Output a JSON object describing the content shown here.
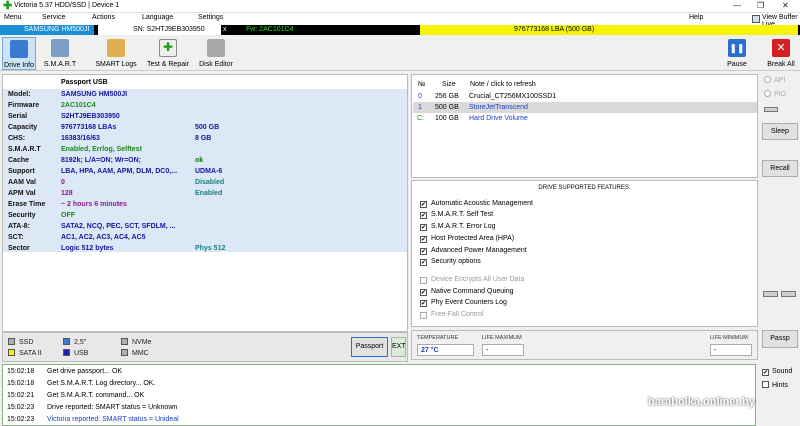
{
  "window": {
    "title": "Victoria 5.37 HDD/SSD | Device 1"
  },
  "menu": [
    "Menu",
    "Service",
    "Actions",
    "Language",
    "Settings",
    "Help"
  ],
  "view_buffer_live": "View Buffer Live",
  "device_bar": {
    "model": "SAMSUNG HM500JI",
    "sn": "SN: S2HTJ9EB303950",
    "x": "x",
    "fw": "Fw: 2AC101C4",
    "lba": "976773168 LBA (500 GB)"
  },
  "toolbar": [
    "Drive Info",
    "S.M.A.R.T",
    "SMART Logs",
    "Test & Repair",
    "Disk Editor"
  ],
  "pause_label": "Pause",
  "break_label": "Break All",
  "passport": {
    "header": "Passport USB",
    "rows": [
      {
        "k": "Model:",
        "v": "SAMSUNG HM500JI",
        "v2": ""
      },
      {
        "k": "Firmware",
        "v": "2AC101C4",
        "v2": ""
      },
      {
        "k": "Serial",
        "v": "S2HTJ9EB303950",
        "v2": ""
      },
      {
        "k": "Capacity",
        "v": "976773168 LBAs",
        "v2": "500 GB"
      },
      {
        "k": "CHS:",
        "v": "16383/16/63",
        "v2": "8 GB"
      },
      {
        "k": "S.M.A.R.T",
        "v": "Enabled, Errlog, Selftest",
        "v2": ""
      },
      {
        "k": "Cache",
        "v": "8192k; L/A=ON; Wr=ON;",
        "v2": "ok"
      },
      {
        "k": "Support",
        "v": "LBA, HPA, AAM, APM, DLM, DC0,...",
        "v2": "UDMA-6"
      },
      {
        "k": "AAM Val",
        "v": "0",
        "v2": "Disabled"
      },
      {
        "k": "APM Val",
        "v": "128",
        "v2": "Enabled"
      },
      {
        "k": "Erase Time",
        "v": "~ 2 hours 6 minutes",
        "v2": ""
      },
      {
        "k": "Security",
        "v": "OFF",
        "v2": ""
      },
      {
        "k": "ATA-8:",
        "v": "SATA2, NCQ, PEC, SCT, SFDLM, ...",
        "v2": ""
      },
      {
        "k": "SCT:",
        "v": "AC1, AC2, AC3, AC4, AC5",
        "v2": ""
      },
      {
        "k": "Sector",
        "v": "Logic 512 bytes",
        "v2": "Phys 512"
      }
    ]
  },
  "legend": {
    "items": [
      "SSD",
      "2,5\"",
      "NVMe",
      "SATA II",
      "USB",
      "MMC"
    ],
    "colors": [
      "#b0b0b0",
      "#3a7ad0",
      "#b0b0b0",
      "#f5f500",
      "#2020b0",
      "#b0b0b0"
    ],
    "passport_button": "Passport",
    "ext_button": "EXT"
  },
  "drive_list": {
    "headers": [
      "№",
      "Size",
      "Note / click to refresh"
    ],
    "rows": [
      {
        "n": "0",
        "size": "256 GB",
        "note": "Crucial_CT256MX100SSD1"
      },
      {
        "n": "1",
        "size": "500 GB",
        "note": "StoreJetTranscend"
      },
      {
        "n": "C:",
        "size": "100 GB",
        "note": "Hard Drive Volume"
      }
    ]
  },
  "features": {
    "title": "DRIVE SUPPORTED FEATURES:",
    "items": [
      {
        "label": "Automatic Acoustic Management",
        "checked": true,
        "enabled": true
      },
      {
        "label": "S.M.A.R.T. Self Test",
        "checked": true,
        "enabled": true
      },
      {
        "label": "S.M.A.R.T. Error Log",
        "checked": true,
        "enabled": true
      },
      {
        "label": "Host Protected Area (HPA)",
        "checked": true,
        "enabled": true
      },
      {
        "label": "Advanced Power Management",
        "checked": true,
        "enabled": true
      },
      {
        "label": "Security options",
        "checked": true,
        "enabled": true
      },
      {
        "label": "Device Encrypts All User Data",
        "checked": false,
        "enabled": false
      },
      {
        "label": "Native Command Queuing",
        "checked": true,
        "enabled": true
      },
      {
        "label": "Phy Event Counters Log",
        "checked": true,
        "enabled": true
      },
      {
        "label": "Free-Fall Control",
        "checked": false,
        "enabled": false
      }
    ]
  },
  "temps": {
    "temperature_label": "TEMPERATURE",
    "temperature_value": "27 °C",
    "life_max_label": "LIFE MAXIMUM",
    "life_max_value": "-",
    "life_min_label": "LIFE MINIMUM",
    "life_min_value": "-"
  },
  "right": {
    "api": "API",
    "pio": "PIO",
    "sleep": "Sleep",
    "recall": "Recall",
    "passp": "Passp",
    "sound": "Sound",
    "hints": "Hints"
  },
  "log": [
    {
      "time": "15:02:18",
      "msg": "Get drive passport... OK",
      "color": "#000"
    },
    {
      "time": "15:02:18",
      "msg": "Get S.M.A.R.T. Log directory... OK.",
      "color": "#000"
    },
    {
      "time": "15:02:21",
      "msg": "Get S.M.A.R.T. command... OK",
      "color": "#000"
    },
    {
      "time": "15:02:23",
      "msg": "Drive reported: SMART status = Unknown",
      "color": "#000"
    },
    {
      "time": "15:02:23",
      "msg": "Victoria reported: SMART status = Unideal",
      "color": "#1a40c0"
    }
  ],
  "watermark": "baraholka.onliner.by"
}
